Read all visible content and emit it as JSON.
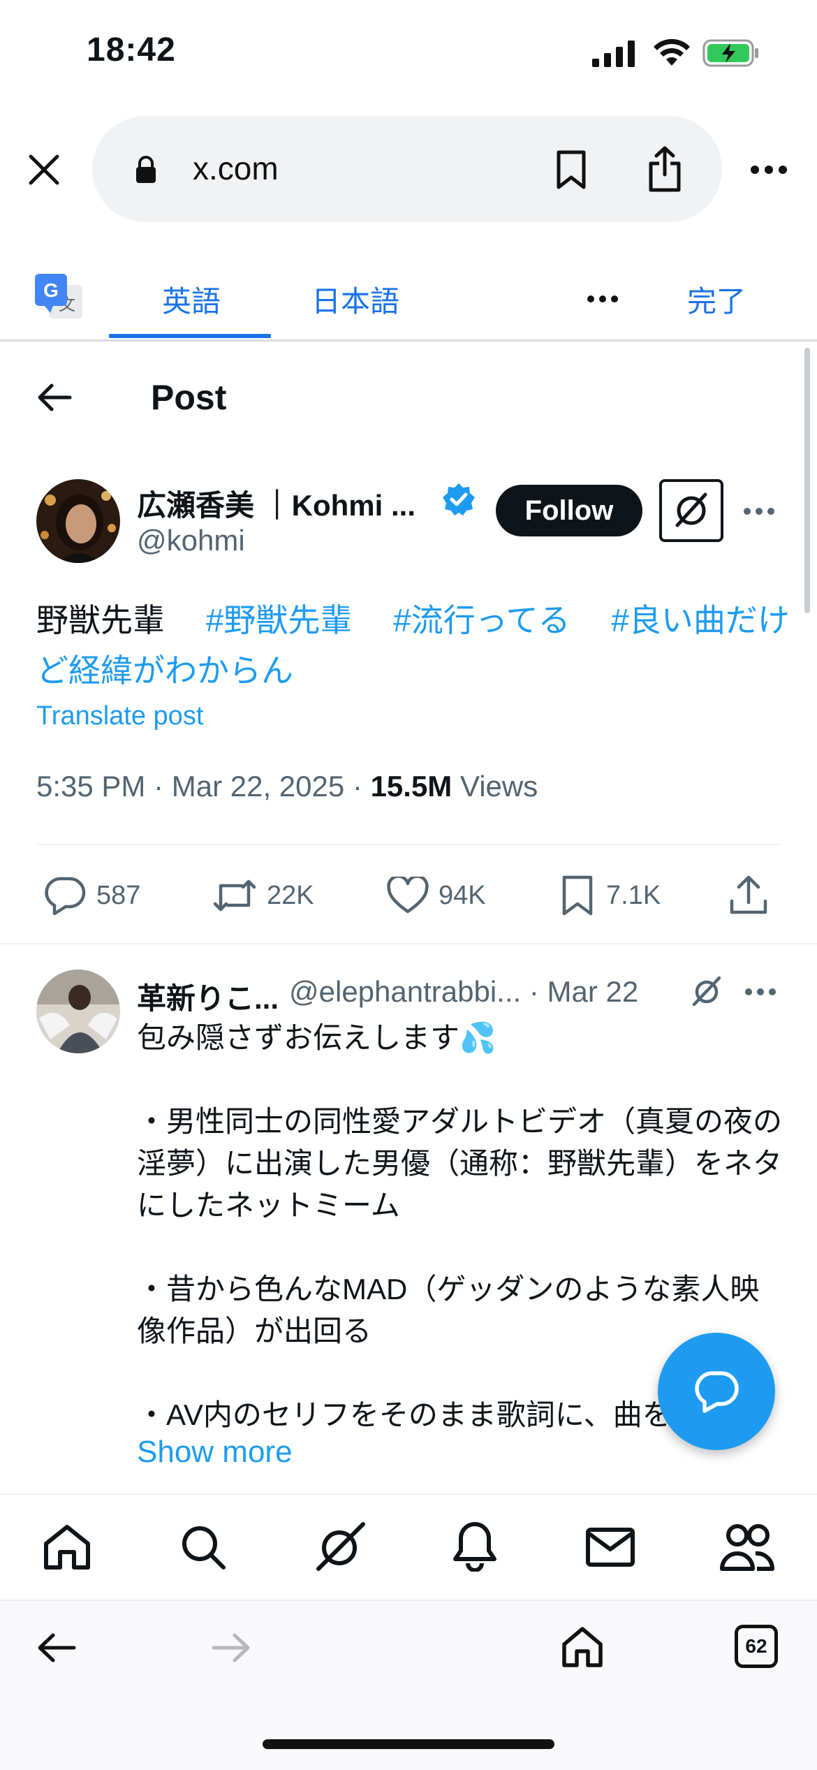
{
  "status_bar": {
    "time": "18:42"
  },
  "browser": {
    "url": "x.com",
    "tab_count": "62"
  },
  "translate_bar": {
    "tabs": [
      {
        "label": "英語"
      },
      {
        "label": "日本語"
      }
    ],
    "done_label": "完了",
    "accent": "#1a73e8"
  },
  "header": {
    "title": "Post"
  },
  "post": {
    "author_name": "広瀬香美 ｜Kohmi ...",
    "handle": "@kohmi",
    "follow_label": "Follow",
    "text_plain": "野獣先輩　",
    "hashtags": [
      "#野獣先輩",
      "#流行ってる",
      "#良い曲だけど経緯がわからん"
    ],
    "translate_label": "Translate post",
    "time": "5:35 PM · Mar 22, 2025 · ",
    "views_count": "15.5M",
    "views_label": " Views",
    "actions": {
      "replies": "587",
      "reposts": "22K",
      "likes": "94K",
      "bookmarks": "7.1K"
    }
  },
  "reply": {
    "author_name": "革新りこ...",
    "handle_date": "@elephantrabbi... · Mar 22",
    "line1": "包み隠さずお伝えします💦",
    "body": "・男性同士の同性愛アダルトビデオ（真夏の夜の淫夢）に出演した男優（通称：野獣先輩）をネタにしたネットミーム\n\n・昔から色んなMAD（ゲッダンのような素人映像作品）が出回る\n\n・AV内のセリフをそのまま歌詞に、曲を",
    "show_more": "Show more"
  },
  "colors": {
    "x_blue": "#1d9bf0",
    "text_primary": "#0f1419",
    "text_secondary": "#536471",
    "verified": "#1d9bf0"
  }
}
